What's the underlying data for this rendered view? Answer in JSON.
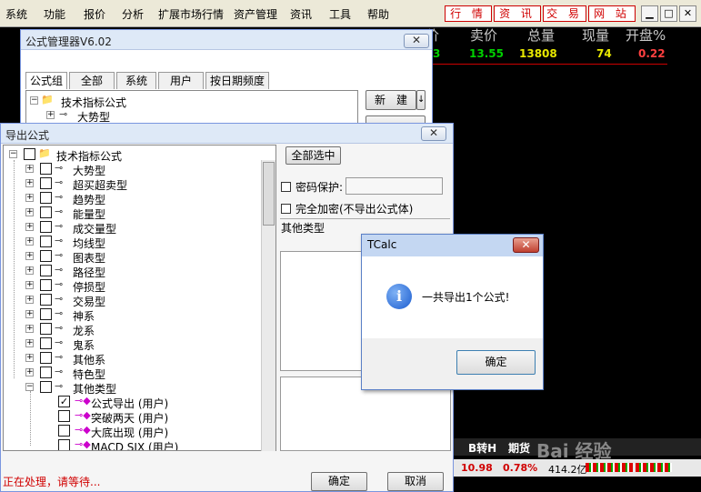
{
  "menubar": {
    "items": [
      "系统",
      "功能",
      "报价",
      "分析",
      "扩展市场行情",
      "资产管理",
      "资讯",
      "工具",
      "帮助"
    ],
    "site_buttons": [
      "行 情",
      "资 讯",
      "交 易",
      "网 站"
    ]
  },
  "quote": {
    "headers": [
      "卖价",
      "总量",
      "现量",
      "开盘%"
    ],
    "partial": "3",
    "ask": "13.55",
    "volume": "13808",
    "current": "74",
    "open_pct": "0.22"
  },
  "manager": {
    "title": "公式管理器V6.02",
    "tabs": [
      "公式组",
      "全部",
      "系统",
      "用户",
      "按日期频度"
    ],
    "tree": [
      "技术指标公式",
      "大势型"
    ],
    "new_button": "新　建",
    "arrow": "↓"
  },
  "export": {
    "title": "导出公式",
    "select_all": "全部选中",
    "password_label": "密码保护:",
    "encrypt_label": "完全加密(不导出公式体)",
    "other_types": "其他类型",
    "root": "技术指标公式",
    "groups": [
      "大势型",
      "超买超卖型",
      "趋势型",
      "能量型",
      "成交量型",
      "均线型",
      "图表型",
      "路径型",
      "停损型",
      "交易型",
      "神系",
      "龙系",
      "鬼系",
      "其他系",
      "特色型",
      "其他类型"
    ],
    "children": [
      {
        "label": "公式导出 (用户)",
        "checked": true
      },
      {
        "label": "突破两天 (用户)",
        "checked": false
      },
      {
        "label": "大底出现 (用户)",
        "checked": false
      },
      {
        "label": "MACD SJX (用户)",
        "checked": false
      }
    ],
    "status": "正在处理，请等待...",
    "ok": "确定",
    "cancel": "取消"
  },
  "dialog": {
    "title": "TCalc",
    "message": "一共导出1个公式!",
    "ok": "确定",
    "info_glyph": "i"
  },
  "bottom": {
    "tabs": [
      "B转H",
      "期货"
    ],
    "values": [
      "10.98",
      "0.78%",
      "414.2亿"
    ],
    "watermark": "Bai 经验"
  },
  "colors": {
    "green": "#00d000",
    "yellow": "#e8e800",
    "red": "#ff4040",
    "title_bg": "#dee9f7"
  }
}
